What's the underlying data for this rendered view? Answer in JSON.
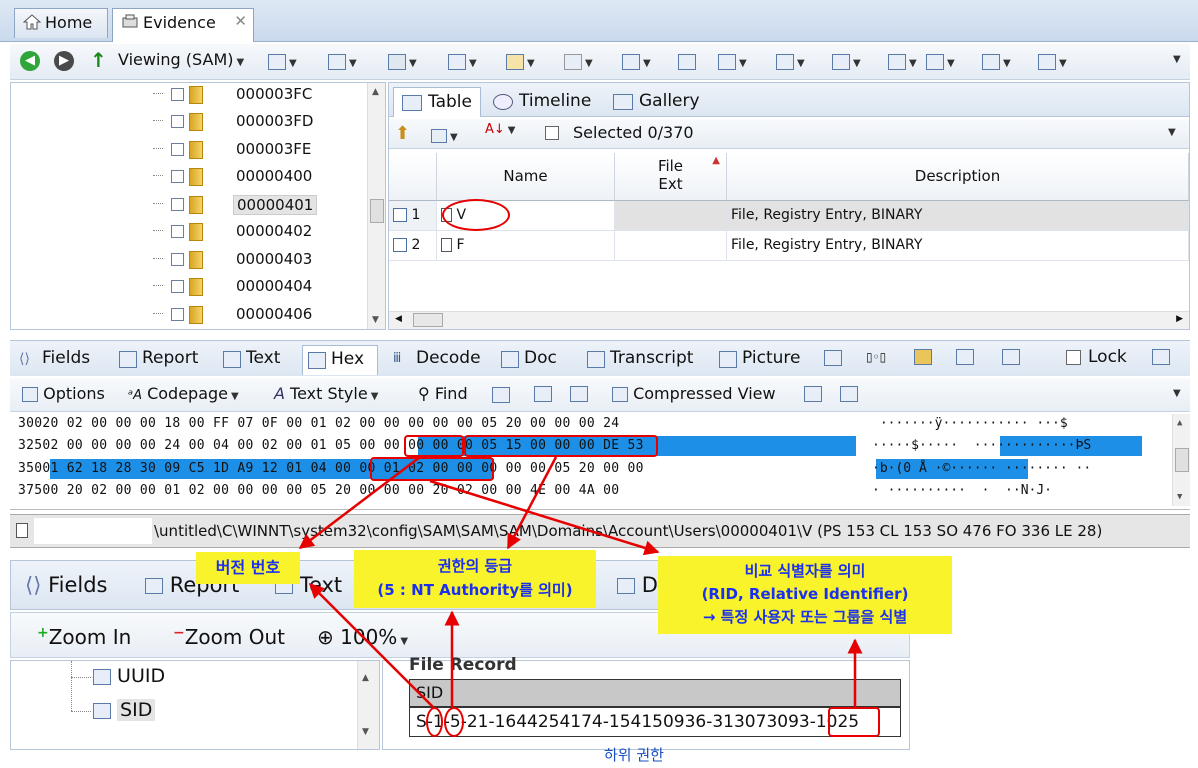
{
  "tabs": [
    {
      "label": "Home",
      "icon": "home-icon"
    },
    {
      "label": "Evidence",
      "icon": "evidence-icon"
    }
  ],
  "toolbar": {
    "viewing_label": "Viewing (SAM)"
  },
  "tree": {
    "items": [
      "000003FC",
      "000003FD",
      "000003FE",
      "00000400",
      "00000401",
      "00000402",
      "00000403",
      "00000404",
      "00000406"
    ],
    "selected": "00000401"
  },
  "right_tabs": [
    "Table",
    "Timeline",
    "Gallery"
  ],
  "table_toolbar": {
    "selected_label": "Selected 0/370"
  },
  "table": {
    "headers": {
      "name": "Name",
      "file_ext_1": "File",
      "file_ext_2": "Ext",
      "description": "Description"
    },
    "rows": [
      {
        "num": "1",
        "name": "V",
        "desc": "File, Registry Entry, BINARY"
      },
      {
        "num": "2",
        "name": "F",
        "desc": "File, Registry Entry, BINARY"
      }
    ]
  },
  "view_tabs": [
    "Fields",
    "Report",
    "Text",
    "Hex",
    "Decode",
    "Doc",
    "Transcript",
    "Picture"
  ],
  "lock_label": "Lock",
  "options_toolbar": {
    "options": "Options",
    "codepage": "Codepage",
    "text_style": "Text Style",
    "find": "Find",
    "compressed": "Compressed View"
  },
  "hex": {
    "rows": [
      {
        "offset": "300",
        "bytes": "20 02 00 00 00 18 00 FF 07 0F 00 01 02 00 00 00 00 00 05 20 00 00 00 24",
        "ascii": " ·······ÿ··········· ···$"
      },
      {
        "offset": "325",
        "bytes": "02 00 00 00 00 24 00 04 00 02 00 01 05 00 00 00 00 00 05 15 00 00 00 DE 53",
        "ascii": "·····$·····  ·············ÞS"
      },
      {
        "offset": "350",
        "bytes": "01 62 18 28 30 09 C5 1D A9 12 01 04 00 00 01 02 00 00 00 00 00 05 20 00 00",
        "ascii": "·b·(0 Å ·©······ ········ ··"
      },
      {
        "offset": "375",
        "bytes": "00 20 02 00 00 01 02 00 00 00 00 05 20 00 00 00 20 02 00 00 4E 00 4A 00",
        "ascii": "· ··········  ·  ··N·J·"
      }
    ]
  },
  "status": {
    "path": "\\untitled\\C\\WINNT\\system32\\config\\SAM\\SAM\\SAM\\Domains\\Account\\Users\\00000401\\V (PS 153 CL 153 SO 476 FO 336 LE 28)"
  },
  "bottom": {
    "tabs": [
      "Fields",
      "Report",
      "Text",
      "D"
    ],
    "zoom_in": "Zoom In",
    "zoom_out": "Zoom Out",
    "zoom_level": "100%",
    "tree": [
      "UUID",
      "SID"
    ],
    "record_title": "File Record",
    "sid_header": "SID",
    "sid_value": "S-1-5-21-1644254174-154150936-313073093-1025"
  },
  "callouts": {
    "version": "버전 번호",
    "authority_1": "권한의 등급",
    "authority_2": "(5 : NT Authority를 의미)",
    "rid_1": "비교 식별자를 의미",
    "rid_2": "(RID, Relative Identifier)",
    "rid_3": "→ 특정 사용자 또는 그룹을 식별",
    "sub_authority": "하위 권한"
  },
  "colors": {
    "accent": "#1e8fe6",
    "callout_bg": "#f8f32a",
    "callout_text": "#1a2ff0",
    "marker": "#e60000"
  }
}
